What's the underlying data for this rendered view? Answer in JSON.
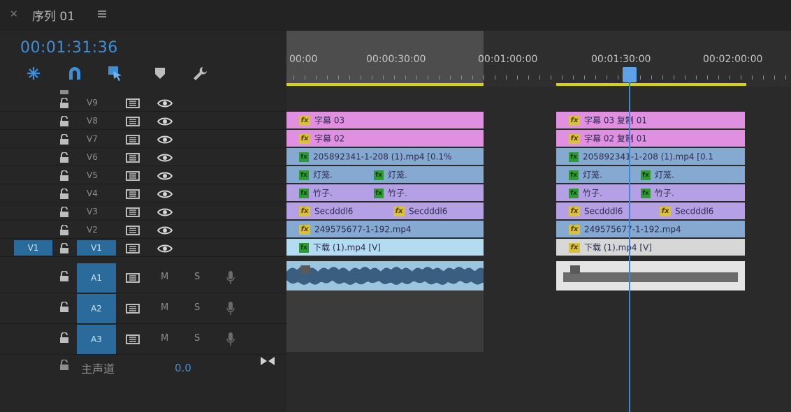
{
  "panel": {
    "close_icon": "×",
    "sequence_title": "序列 01",
    "menu_icon": "hamburger-menu-icon"
  },
  "timecode": "00:01:31:36",
  "tools": [
    "ripple-icon",
    "snap-magnet-icon",
    "linked-selection-icon",
    "add-marker-icon",
    "settings-wrench-icon"
  ],
  "tracks": {
    "video": [
      {
        "label": "V9"
      },
      {
        "label": "V8"
      },
      {
        "label": "V7"
      },
      {
        "label": "V6"
      },
      {
        "label": "V5"
      },
      {
        "label": "V4"
      },
      {
        "label": "V3"
      },
      {
        "label": "V2"
      },
      {
        "label": "V1"
      }
    ],
    "v1_source_target": "V1",
    "audio": [
      {
        "label": "A1",
        "mute": "M",
        "solo": "S"
      },
      {
        "label": "A2",
        "mute": "M",
        "solo": "S"
      },
      {
        "label": "A3",
        "mute": "M",
        "solo": "S"
      }
    ],
    "master": {
      "label": "主声道",
      "value": "0.0"
    }
  },
  "ruler": {
    "labels": [
      "00:00",
      "00:00:30:00",
      "00:01:00:00",
      "00:01:30:00",
      "00:02:00:00"
    ]
  },
  "clips": {
    "group1": {
      "v8": "字幕 03",
      "v7": "字幕 02",
      "v6": "205892341-1-208 (1).mp4 [0.1%",
      "v5a": "灯笼.",
      "v5b": "灯笼.",
      "v4a": "竹子.",
      "v4b": "竹子.",
      "v3a": "Secdddl6",
      "v3b": "Secdddl6",
      "v2": "249575677-1-192.mp4",
      "v1": "下载 (1).mp4 [V]"
    },
    "group2": {
      "v8": "字幕 03 复制 01",
      "v7": "字幕 02 复制 01",
      "v6": "205892341-1-208 (1).mp4 [0.1",
      "v5a": "灯笼.",
      "v5b": "灯笼.",
      "v4a": "竹子.",
      "v4b": "竹子.",
      "v3a": "Secdddl6",
      "v3b": "Secdddl6",
      "v2": "249575677-1-192.mp4",
      "v1": "下载 (1).mp4 [V]"
    },
    "fx_label": "fx"
  },
  "colors": {
    "timecode": "#3e8ed8",
    "track_target": "#2a6b9b",
    "title_clip": "#e18fe0",
    "video_clip": "#86a9d1",
    "nested_clip": "#b5a0e6",
    "work_area": "#d8d20c",
    "playhead": "#3f86d6"
  }
}
